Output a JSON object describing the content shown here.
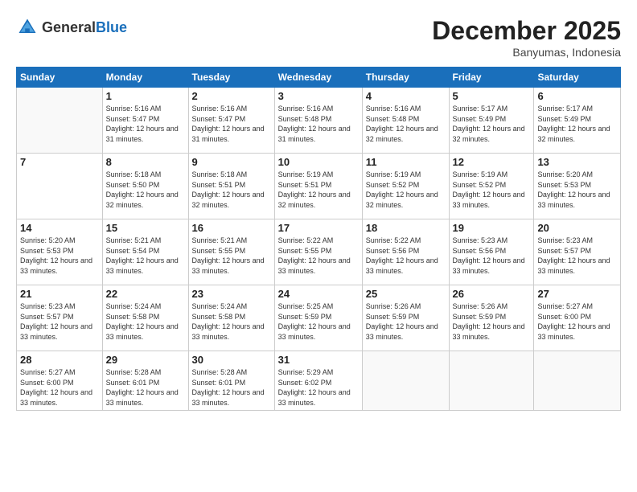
{
  "header": {
    "logo_general": "General",
    "logo_blue": "Blue",
    "month_title": "December 2025",
    "subtitle": "Banyumas, Indonesia"
  },
  "days_of_week": [
    "Sunday",
    "Monday",
    "Tuesday",
    "Wednesday",
    "Thursday",
    "Friday",
    "Saturday"
  ],
  "weeks": [
    [
      {
        "day": "",
        "info": ""
      },
      {
        "day": "1",
        "info": "Sunrise: 5:16 AM\nSunset: 5:47 PM\nDaylight: 12 hours\nand 31 minutes."
      },
      {
        "day": "2",
        "info": "Sunrise: 5:16 AM\nSunset: 5:47 PM\nDaylight: 12 hours\nand 31 minutes."
      },
      {
        "day": "3",
        "info": "Sunrise: 5:16 AM\nSunset: 5:48 PM\nDaylight: 12 hours\nand 31 minutes."
      },
      {
        "day": "4",
        "info": "Sunrise: 5:16 AM\nSunset: 5:48 PM\nDaylight: 12 hours\nand 32 minutes."
      },
      {
        "day": "5",
        "info": "Sunrise: 5:17 AM\nSunset: 5:49 PM\nDaylight: 12 hours\nand 32 minutes."
      },
      {
        "day": "6",
        "info": "Sunrise: 5:17 AM\nSunset: 5:49 PM\nDaylight: 12 hours\nand 32 minutes."
      }
    ],
    [
      {
        "day": "7",
        "info": ""
      },
      {
        "day": "8",
        "info": "Sunrise: 5:18 AM\nSunset: 5:50 PM\nDaylight: 12 hours\nand 32 minutes."
      },
      {
        "day": "9",
        "info": "Sunrise: 5:18 AM\nSunset: 5:51 PM\nDaylight: 12 hours\nand 32 minutes."
      },
      {
        "day": "10",
        "info": "Sunrise: 5:19 AM\nSunset: 5:51 PM\nDaylight: 12 hours\nand 32 minutes."
      },
      {
        "day": "11",
        "info": "Sunrise: 5:19 AM\nSunset: 5:52 PM\nDaylight: 12 hours\nand 32 minutes."
      },
      {
        "day": "12",
        "info": "Sunrise: 5:19 AM\nSunset: 5:52 PM\nDaylight: 12 hours\nand 33 minutes."
      },
      {
        "day": "13",
        "info": "Sunrise: 5:20 AM\nSunset: 5:53 PM\nDaylight: 12 hours\nand 33 minutes."
      }
    ],
    [
      {
        "day": "14",
        "info": "Sunrise: 5:20 AM\nSunset: 5:53 PM\nDaylight: 12 hours\nand 33 minutes."
      },
      {
        "day": "15",
        "info": "Sunrise: 5:21 AM\nSunset: 5:54 PM\nDaylight: 12 hours\nand 33 minutes."
      },
      {
        "day": "16",
        "info": "Sunrise: 5:21 AM\nSunset: 5:55 PM\nDaylight: 12 hours\nand 33 minutes."
      },
      {
        "day": "17",
        "info": "Sunrise: 5:22 AM\nSunset: 5:55 PM\nDaylight: 12 hours\nand 33 minutes."
      },
      {
        "day": "18",
        "info": "Sunrise: 5:22 AM\nSunset: 5:56 PM\nDaylight: 12 hours\nand 33 minutes."
      },
      {
        "day": "19",
        "info": "Sunrise: 5:23 AM\nSunset: 5:56 PM\nDaylight: 12 hours\nand 33 minutes."
      },
      {
        "day": "20",
        "info": "Sunrise: 5:23 AM\nSunset: 5:57 PM\nDaylight: 12 hours\nand 33 minutes."
      }
    ],
    [
      {
        "day": "21",
        "info": "Sunrise: 5:23 AM\nSunset: 5:57 PM\nDaylight: 12 hours\nand 33 minutes."
      },
      {
        "day": "22",
        "info": "Sunrise: 5:24 AM\nSunset: 5:58 PM\nDaylight: 12 hours\nand 33 minutes."
      },
      {
        "day": "23",
        "info": "Sunrise: 5:24 AM\nSunset: 5:58 PM\nDaylight: 12 hours\nand 33 minutes."
      },
      {
        "day": "24",
        "info": "Sunrise: 5:25 AM\nSunset: 5:59 PM\nDaylight: 12 hours\nand 33 minutes."
      },
      {
        "day": "25",
        "info": "Sunrise: 5:26 AM\nSunset: 5:59 PM\nDaylight: 12 hours\nand 33 minutes."
      },
      {
        "day": "26",
        "info": "Sunrise: 5:26 AM\nSunset: 5:59 PM\nDaylight: 12 hours\nand 33 minutes."
      },
      {
        "day": "27",
        "info": "Sunrise: 5:27 AM\nSunset: 6:00 PM\nDaylight: 12 hours\nand 33 minutes."
      }
    ],
    [
      {
        "day": "28",
        "info": "Sunrise: 5:27 AM\nSunset: 6:00 PM\nDaylight: 12 hours\nand 33 minutes."
      },
      {
        "day": "29",
        "info": "Sunrise: 5:28 AM\nSunset: 6:01 PM\nDaylight: 12 hours\nand 33 minutes."
      },
      {
        "day": "30",
        "info": "Sunrise: 5:28 AM\nSunset: 6:01 PM\nDaylight: 12 hours\nand 33 minutes."
      },
      {
        "day": "31",
        "info": "Sunrise: 5:29 AM\nSunset: 6:02 PM\nDaylight: 12 hours\nand 33 minutes."
      },
      {
        "day": "",
        "info": ""
      },
      {
        "day": "",
        "info": ""
      },
      {
        "day": "",
        "info": ""
      }
    ]
  ]
}
